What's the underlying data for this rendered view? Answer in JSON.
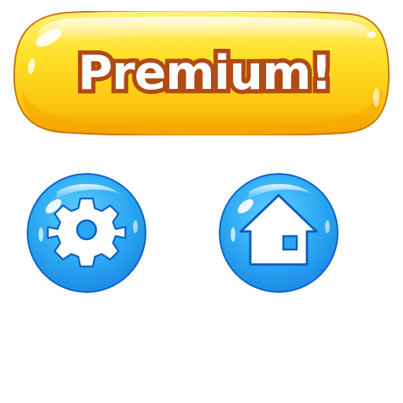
{
  "premium_button": {
    "label": "Premium!",
    "colors": {
      "fill_top": "#ffe23a",
      "fill_bottom": "#f7ad00",
      "outline": "#c9770a",
      "text": "#ffffff",
      "text_outline": "#b14a14"
    }
  },
  "settings_button": {
    "icon": "gear-icon",
    "colors": {
      "fill": "#2aa6f2",
      "outline": "#0a63c9",
      "glyph": "#ffffff"
    }
  },
  "home_button": {
    "icon": "house-icon",
    "colors": {
      "fill": "#2aa6f2",
      "outline": "#0a63c9",
      "glyph": "#ffffff"
    }
  }
}
